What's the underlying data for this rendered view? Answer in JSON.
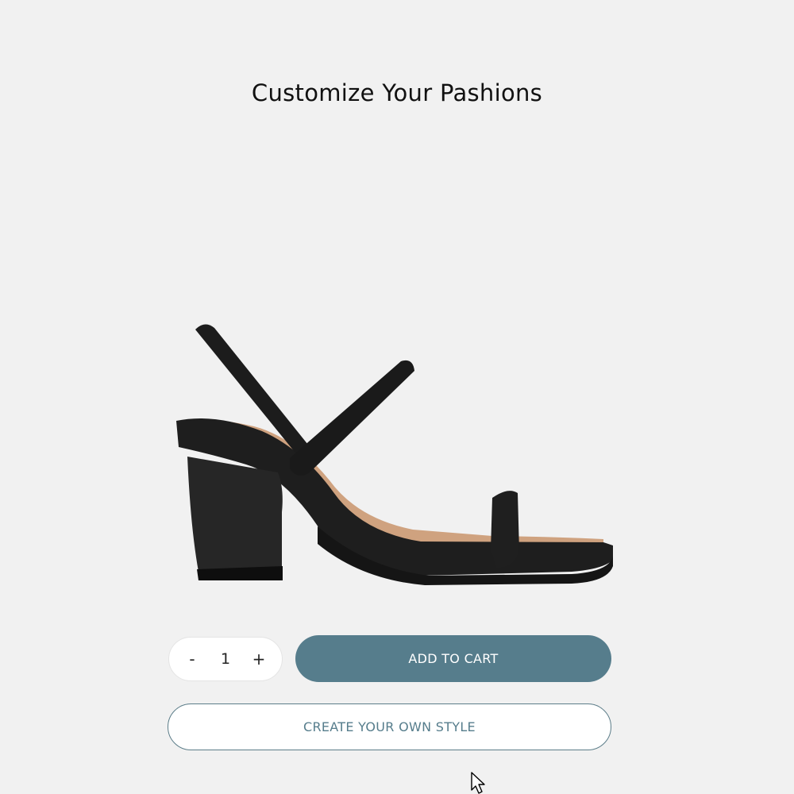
{
  "page": {
    "title": "Customize Your Pashions"
  },
  "product": {
    "image_icon": "strappy-block-heel-sandal",
    "colors": {
      "strap": "#1c1c1c",
      "insole": "#cfa27f",
      "sole": "#202020"
    }
  },
  "quantity": {
    "decrement_label": "-",
    "value": "1",
    "increment_label": "+"
  },
  "actions": {
    "add_to_cart_label": "ADD TO CART",
    "create_style_label": "CREATE YOUR OWN STYLE"
  },
  "colors": {
    "accent": "#567d8c",
    "background": "#f1f1f1"
  }
}
